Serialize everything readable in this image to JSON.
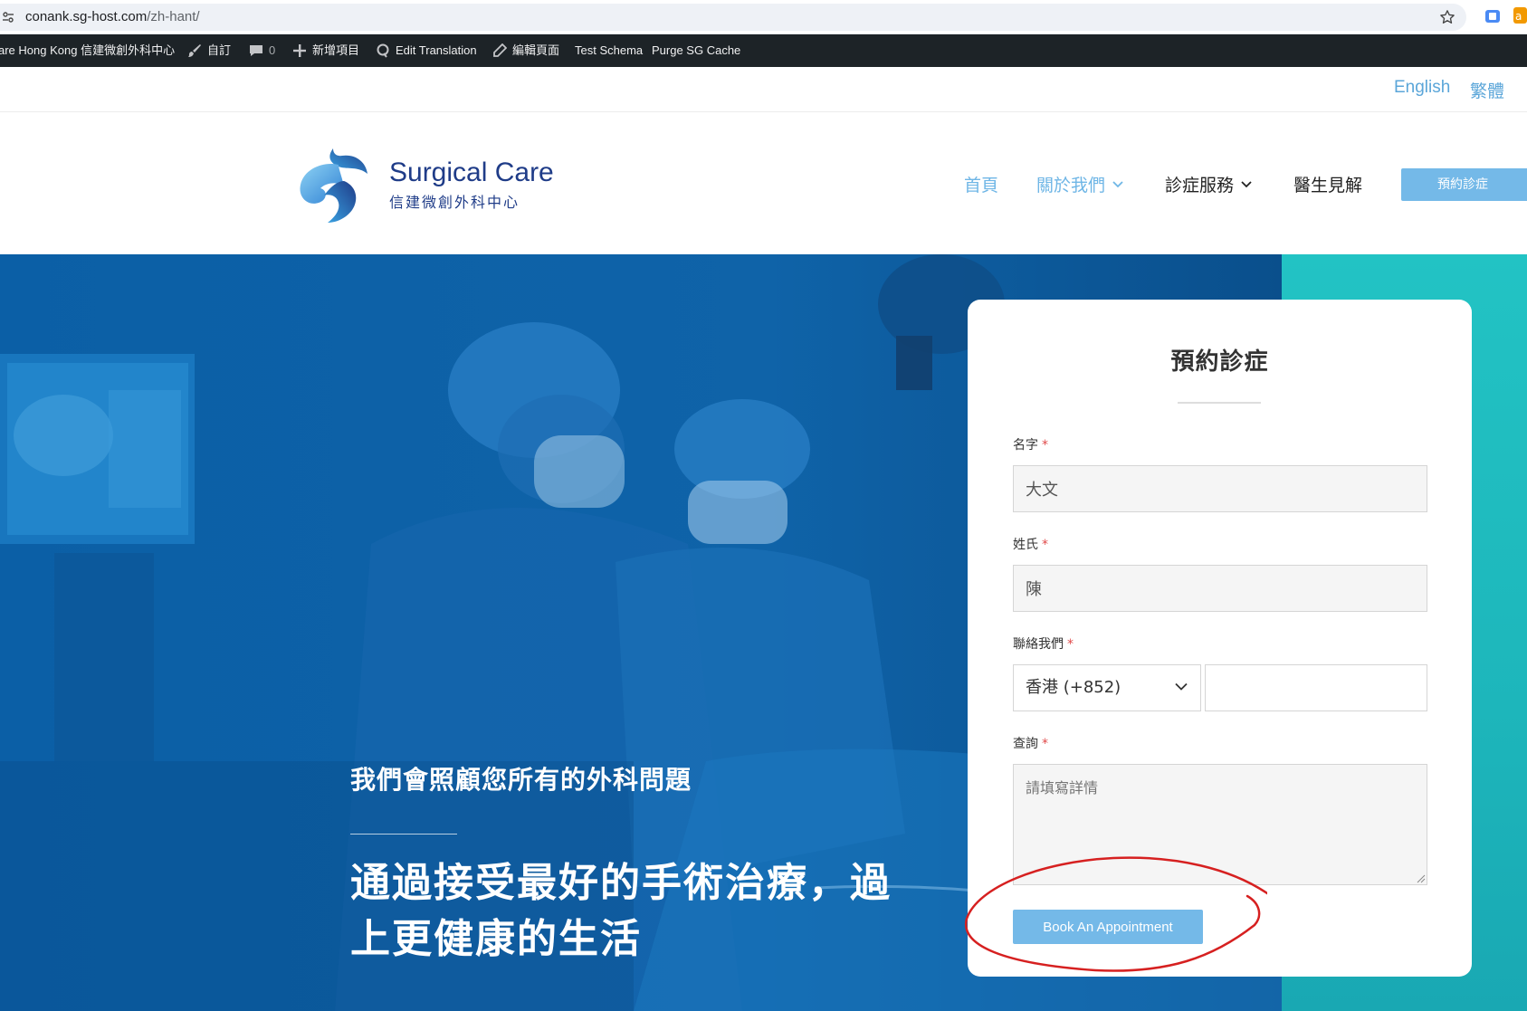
{
  "browser": {
    "url_host": "conank.sg-host.com",
    "url_path": "/zh-hant/"
  },
  "admin_bar": {
    "site_name": "are Hong Kong 信建微創外科中心",
    "customize": "自訂",
    "comments_count": "0",
    "new_item": "新增項目",
    "edit_translation": "Edit Translation",
    "edit_page": "編輯頁面",
    "test_schema": "Test Schema",
    "purge_cache": "Purge SG Cache"
  },
  "language_switcher": {
    "english": "English",
    "traditional": "繁體"
  },
  "header": {
    "logo_name": "Surgical Care",
    "logo_subtitle": "信建微創外科中心",
    "nav": {
      "home": "首頁",
      "about": "關於我們",
      "services": "診症服務",
      "insights": "醫生見解",
      "cta": "預約診症"
    }
  },
  "hero": {
    "subtitle": "我們會照顧您所有的外科問題",
    "title": "通過接受最好的手術治療，過上更健康的生活"
  },
  "form": {
    "title": "預約診症",
    "first_name_label": "名字",
    "first_name_value": "大文",
    "last_name_label": "姓氏",
    "last_name_value": "陳",
    "contact_label": "聯絡我們",
    "country_code": "香港 (+852)",
    "enquiry_label": "查詢",
    "enquiry_placeholder": "請填寫詳情",
    "required_mark": "*",
    "submit_label": "Book An Appointment"
  },
  "colors": {
    "admin_bar": "#1d2327",
    "accent_blue": "#74b9e8",
    "brand_navy": "#1f3c88",
    "hero_blue": "#0d5ea3",
    "hero_teal": "#22c3c4",
    "annotation_red": "#d62020"
  }
}
